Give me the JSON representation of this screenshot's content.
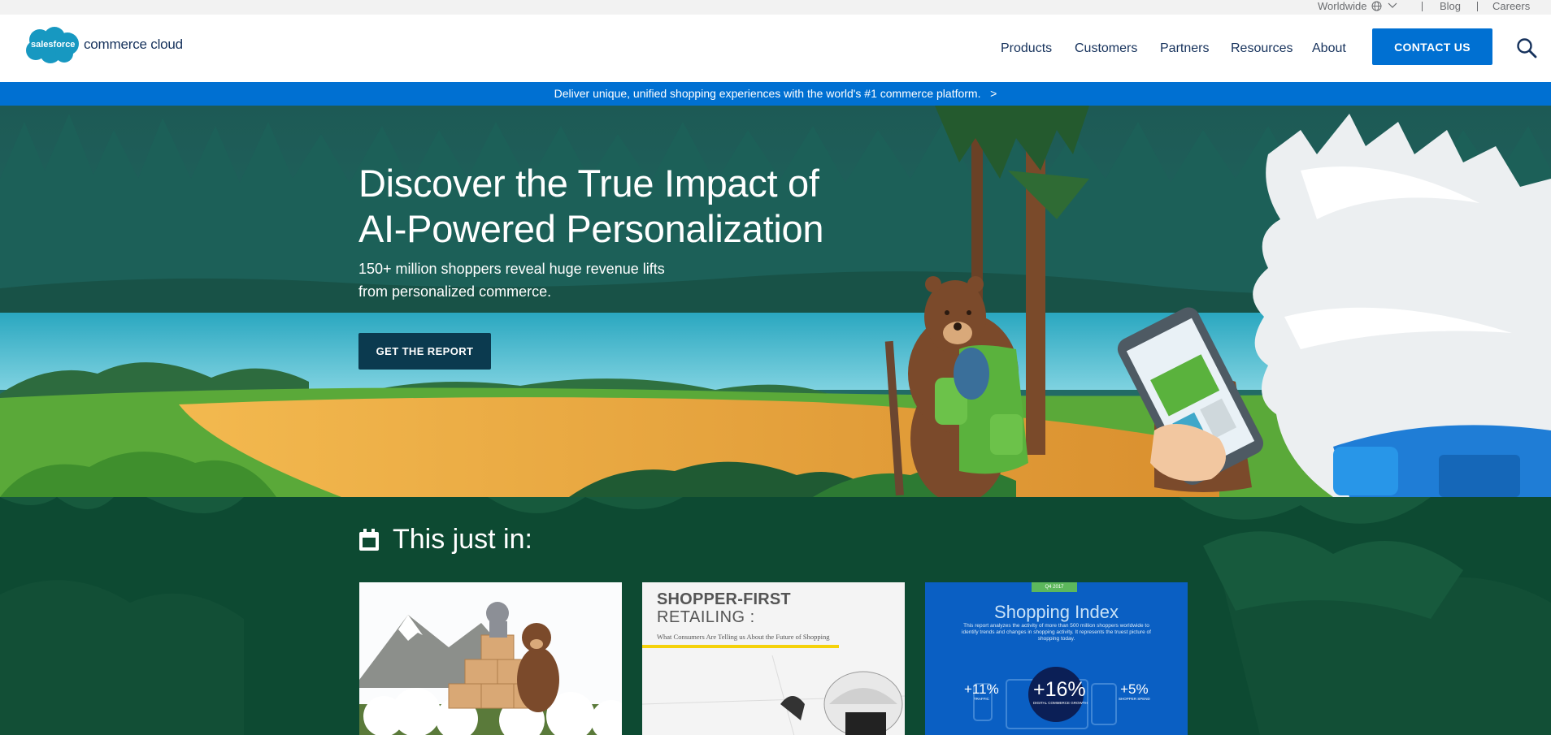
{
  "utility": {
    "worldwide": "Worldwide",
    "blog": "Blog",
    "careers": "Careers"
  },
  "header": {
    "logo_cloud_text": "salesforce",
    "logo_product_text": "commerce cloud",
    "nav": [
      "Products",
      "Customers",
      "Partners",
      "Resources",
      "About"
    ],
    "contact_label": "CONTACT US"
  },
  "announcement": {
    "text": "Deliver unique, unified shopping experiences with the world's #1 commerce platform.",
    "arrow": ">"
  },
  "hero": {
    "title_line1": "Discover the True Impact of",
    "title_line2": "AI-Powered Personalization",
    "subtitle_line1": "150+ million shoppers reveal huge revenue lifts",
    "subtitle_line2": "from personalized commerce.",
    "button_label": "GET THE REPORT"
  },
  "news": {
    "heading": "This just in:",
    "cards": [
      {
        "kind": "illustration"
      },
      {
        "title_line1": "SHOPPER-FIRST",
        "title_line2": "RETAILING :",
        "subtitle": "What Consumers Are Telling us About the Future of Shopping"
      },
      {
        "label": "Q4 2017",
        "title": "Shopping Index",
        "description": "This report analyzes the activity of more than 500 million shoppers worldwide to identify trends and changes in shopping activity. It represents the truest picture of shopping today.",
        "stat_left_value": "+11%",
        "stat_left_label": "TRAFFIC",
        "stat_center_value": "+16%",
        "stat_center_label": "DIGITAL COMMERCE GROWTH",
        "stat_right_value": "+5%",
        "stat_right_label": "SHOPPER SPEND"
      }
    ]
  },
  "colors": {
    "brand_blue": "#0070d2",
    "hero_button": "#0b3a4f",
    "section_green": "#0d4a32",
    "navy_text": "#16325c"
  }
}
